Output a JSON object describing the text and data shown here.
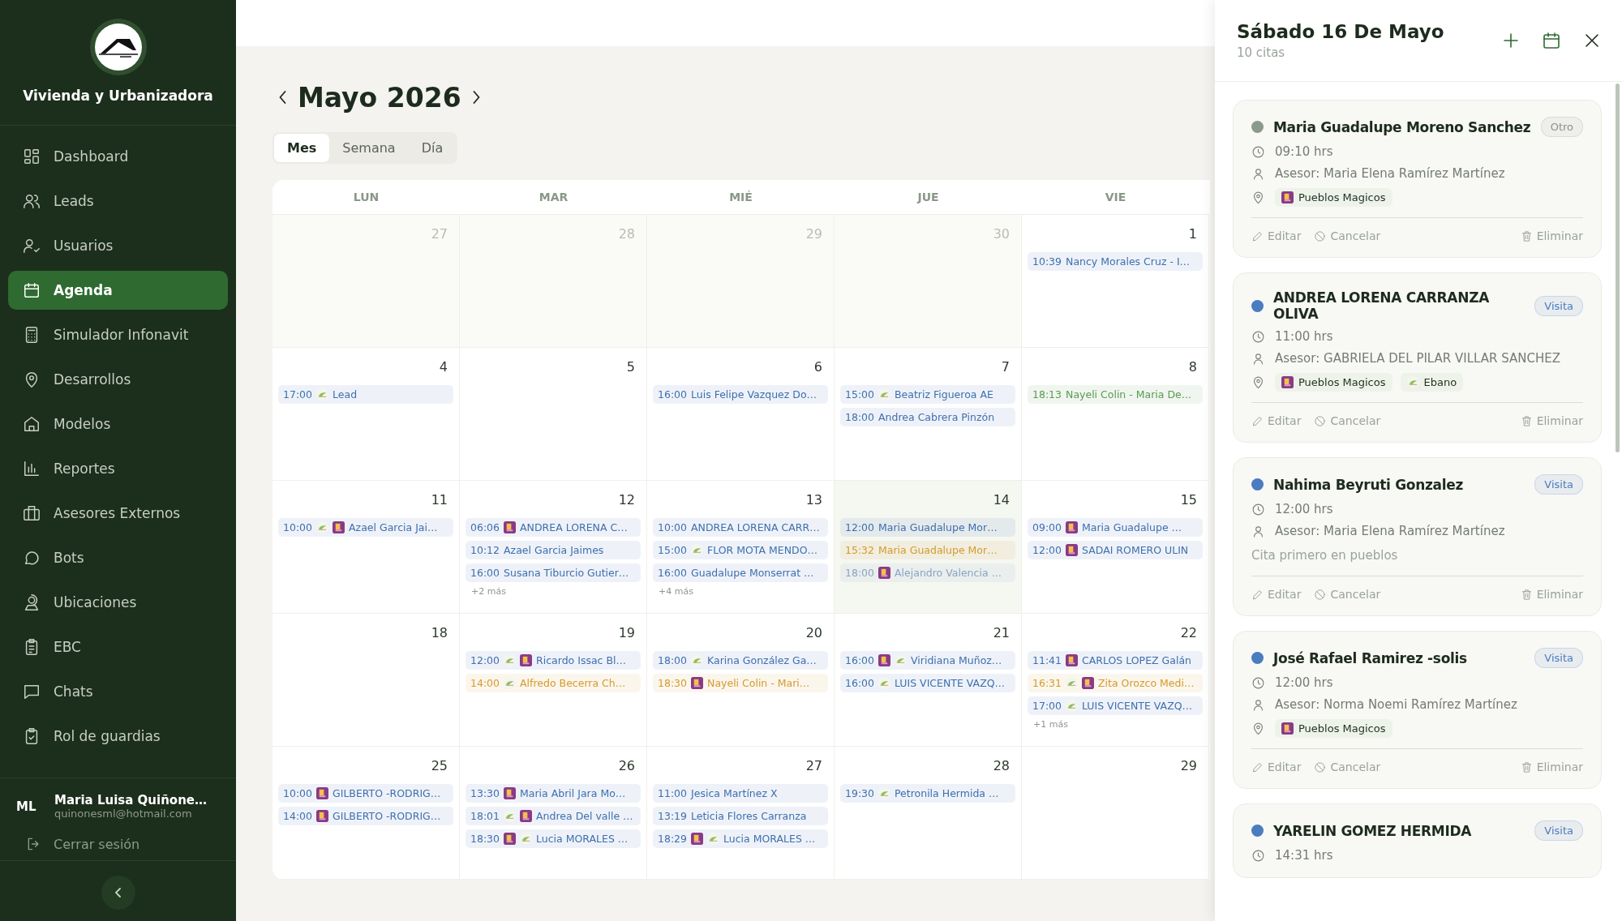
{
  "sidebar": {
    "brand": "Vivienda y Urbanizadora",
    "items": [
      {
        "label": "Dashboard",
        "selected": false
      },
      {
        "label": "Leads",
        "selected": false
      },
      {
        "label": "Usuarios",
        "selected": false
      },
      {
        "label": "Agenda",
        "selected": true
      },
      {
        "label": "Simulador Infonavit",
        "selected": false
      },
      {
        "label": "Desarrollos",
        "selected": false
      },
      {
        "label": "Modelos",
        "selected": false
      },
      {
        "label": "Reportes",
        "selected": false
      },
      {
        "label": "Asesores Externos",
        "selected": false
      },
      {
        "label": "Bots",
        "selected": false
      },
      {
        "label": "Ubicaciones",
        "selected": false
      },
      {
        "label": "EBC",
        "selected": false
      },
      {
        "label": "Chats",
        "selected": false
      },
      {
        "label": "Rol de guardias",
        "selected": false
      }
    ],
    "user": {
      "initials": "ML",
      "name": "Maria Luisa Quiñone…",
      "email": "quinonesml@hotmail.com"
    },
    "logout": "Cerrar sesión"
  },
  "header": {
    "month": "Mayo 2026"
  },
  "views": [
    {
      "label": "Mes",
      "selected": true
    },
    {
      "label": "Semana",
      "selected": false
    },
    {
      "label": "Día",
      "selected": false
    }
  ],
  "calendar": {
    "weekdays": [
      "LUN",
      "MAR",
      "MIÉ",
      "JUE",
      "VIE"
    ],
    "weeks": [
      [
        {
          "day": "27",
          "outside": true,
          "highlighted": false
        },
        {
          "day": "28",
          "outside": true,
          "highlighted": false
        },
        {
          "day": "29",
          "outside": true,
          "highlighted": false
        },
        {
          "day": "30",
          "outside": true,
          "highlighted": false
        },
        {
          "day": "1",
          "outside": false,
          "highlighted": false,
          "events": [
            {
              "time": "10:39",
              "title": "Nancy Morales Cruz - I…",
              "color": "#3e6fb0"
            }
          ]
        }
      ],
      [
        {
          "day": "4",
          "outside": false,
          "highlighted": false,
          "events": [
            {
              "time": "17:00",
              "title": "Lead",
              "color": "#3e6fb0",
              "logos": [
                {
                  "kind": "leaf"
                }
              ]
            }
          ]
        },
        {
          "day": "5",
          "outside": false,
          "highlighted": false
        },
        {
          "day": "6",
          "outside": false,
          "highlighted": false,
          "events": [
            {
              "time": "16:00",
              "title": "Luis Felipe Vazquez Do…",
              "color": "#3e6fb0"
            }
          ]
        },
        {
          "day": "7",
          "outside": false,
          "highlighted": false,
          "events": [
            {
              "time": "15:00",
              "title": "Beatriz Figueroa AE",
              "color": "#3e6fb0",
              "logos": [
                {
                  "kind": "leaf"
                }
              ]
            },
            {
              "time": "18:00",
              "title": "Andrea Cabrera Pinzón",
              "color": "#3e6fb0"
            }
          ]
        },
        {
          "day": "8",
          "outside": false,
          "highlighted": false,
          "events": [
            {
              "time": "18:13",
              "title": "Nayeli Colin - Maria De…",
              "color": "#5a9a52"
            }
          ]
        }
      ],
      [
        {
          "day": "11",
          "outside": false,
          "highlighted": false,
          "events": [
            {
              "time": "10:00",
              "title": "Azael Garcia Jai…",
              "color": "#3e6fb0",
              "logos": [
                {
                  "kind": "leaf"
                },
                {
                  "kind": "tile"
                }
              ]
            }
          ]
        },
        {
          "day": "12",
          "outside": false,
          "highlighted": false,
          "events": [
            {
              "time": "06:06",
              "title": "ANDREA LORENA C…",
              "color": "#3e6fb0",
              "logos": [
                {
                  "kind": "tile"
                }
              ]
            },
            {
              "time": "10:12",
              "title": "Azael Garcia Jaimes",
              "color": "#3e6fb0"
            },
            {
              "time": "16:00",
              "title": "Susana Tiburcio Gutier…",
              "color": "#3e6fb0"
            }
          ],
          "more": "+2 más"
        },
        {
          "day": "13",
          "outside": false,
          "highlighted": false,
          "events": [
            {
              "time": "10:00",
              "title": "ANDREA LORENA CARR…",
              "color": "#3e6fb0"
            },
            {
              "time": "15:00",
              "title": "FLOR MOTA MENDO…",
              "color": "#3e6fb0",
              "logos": [
                {
                  "kind": "leaf"
                }
              ]
            },
            {
              "time": "16:00",
              "title": "Guadalupe Monserrat …",
              "color": "#3e6fb0"
            }
          ],
          "more": "+4 más"
        },
        {
          "day": "14",
          "outside": false,
          "highlighted": true,
          "events": [
            {
              "time": "12:00",
              "title": "Maria Guadalupe Mor…",
              "color": "#3e6fb0"
            },
            {
              "time": "15:32",
              "title": "Maria Guadalupe Mor…",
              "color": "#d59a2e"
            },
            {
              "time": "18:00",
              "title": "Alejandro Valencia …",
              "color": "#8aa3c4",
              "logos": [
                {
                  "kind": "tile"
                }
              ]
            }
          ]
        },
        {
          "day": "15",
          "outside": false,
          "highlighted": false,
          "events": [
            {
              "time": "09:00",
              "title": "Maria Guadalupe …",
              "color": "#3e6fb0",
              "logos": [
                {
                  "kind": "tile"
                }
              ]
            },
            {
              "time": "12:00",
              "title": "SADAI ROMERO ULIN",
              "color": "#3e6fb0",
              "logos": [
                {
                  "kind": "tile"
                }
              ]
            }
          ]
        }
      ],
      [
        {
          "day": "18",
          "outside": false,
          "highlighted": false
        },
        {
          "day": "19",
          "outside": false,
          "highlighted": false,
          "events": [
            {
              "time": "12:00",
              "title": "Ricardo Issac Bl…",
              "color": "#3e6fb0",
              "logos": [
                {
                  "kind": "leaf"
                },
                {
                  "kind": "tile"
                }
              ]
            },
            {
              "time": "14:00",
              "title": "Alfredo Becerra Ch…",
              "color": "#d59a2e",
              "logos": [
                {
                  "kind": "leaf"
                }
              ]
            }
          ]
        },
        {
          "day": "20",
          "outside": false,
          "highlighted": false,
          "events": [
            {
              "time": "18:00",
              "title": "Karina González Ga…",
              "color": "#3e6fb0",
              "logos": [
                {
                  "kind": "leaf"
                }
              ]
            },
            {
              "time": "18:30",
              "title": "Nayeli Colin - Mari…",
              "color": "#d59a2e",
              "logos": [
                {
                  "kind": "tile"
                }
              ]
            }
          ]
        },
        {
          "day": "21",
          "outside": false,
          "highlighted": false,
          "events": [
            {
              "time": "16:00",
              "title": "Viridiana Muñoz…",
              "color": "#3e6fb0",
              "logos": [
                {
                  "kind": "tile"
                },
                {
                  "kind": "leaf"
                }
              ]
            },
            {
              "time": "16:00",
              "title": "LUIS VICENTE VAZQ…",
              "color": "#3e6fb0",
              "logos": [
                {
                  "kind": "leaf"
                }
              ]
            }
          ]
        },
        {
          "day": "22",
          "outside": false,
          "highlighted": false,
          "events": [
            {
              "time": "11:41",
              "title": "CARLOS LOPEZ Galán",
              "color": "#3e6fb0",
              "logos": [
                {
                  "kind": "tile"
                }
              ]
            },
            {
              "time": "16:31",
              "title": "Zita Orozco Medi…",
              "color": "#d59a2e",
              "logos": [
                {
                  "kind": "leaf"
                },
                {
                  "kind": "tile"
                }
              ]
            },
            {
              "time": "17:00",
              "title": "LUIS VICENTE VAZQ…",
              "color": "#3e6fb0",
              "logos": [
                {
                  "kind": "leaf"
                }
              ]
            }
          ],
          "more": "+1 más"
        }
      ],
      [
        {
          "day": "25",
          "outside": false,
          "highlighted": false,
          "events": [
            {
              "time": "10:00",
              "title": "GILBERTO -RODRIG…",
              "color": "#3e6fb0",
              "logos": [
                {
                  "kind": "tile"
                }
              ]
            },
            {
              "time": "14:00",
              "title": "GILBERTO -RODRIG…",
              "color": "#3e6fb0",
              "logos": [
                {
                  "kind": "tile"
                }
              ]
            }
          ]
        },
        {
          "day": "26",
          "outside": false,
          "highlighted": false,
          "events": [
            {
              "time": "13:30",
              "title": "Maria Abril Jara Mo…",
              "color": "#3e6fb0",
              "logos": [
                {
                  "kind": "tile"
                }
              ]
            },
            {
              "time": "18:01",
              "title": "Andrea Del valle …",
              "color": "#3e6fb0",
              "logos": [
                {
                  "kind": "leaf"
                },
                {
                  "kind": "tile"
                }
              ]
            },
            {
              "time": "18:30",
              "title": "Lucia MORALES …",
              "color": "#3e6fb0",
              "logos": [
                {
                  "kind": "tile"
                },
                {
                  "kind": "leaf"
                }
              ]
            }
          ]
        },
        {
          "day": "27",
          "outside": false,
          "highlighted": false,
          "events": [
            {
              "time": "11:00",
              "title": "Jesica Martínez X",
              "color": "#3e6fb0"
            },
            {
              "time": "13:19",
              "title": "Leticia Flores Carranza",
              "color": "#3e6fb0"
            },
            {
              "time": "18:29",
              "title": "Lucia MORALES …",
              "color": "#3e6fb0",
              "logos": [
                {
                  "kind": "tile"
                },
                {
                  "kind": "leaf"
                }
              ]
            }
          ]
        },
        {
          "day": "28",
          "outside": false,
          "highlighted": false,
          "events": [
            {
              "time": "19:30",
              "title": "Petronila Hermida …",
              "color": "#3e6fb0",
              "logos": [
                {
                  "kind": "leaf"
                }
              ]
            }
          ]
        },
        {
          "day": "29",
          "outside": false,
          "highlighted": false
        }
      ]
    ]
  },
  "panel": {
    "title": "Sábado 16 De Mayo",
    "count": "10 citas",
    "appointments": [
      {
        "color": "#8c9a8c",
        "name": "Maria Guadalupe Moreno Sanchez",
        "tag": {
          "label": "Otro",
          "color": "#8b918a"
        },
        "time": "09:10 hrs",
        "advisor": "Asesor: Maria Elena Ramírez Martínez",
        "places": [
          {
            "label": "Pueblos Magicos",
            "kind": "tile"
          }
        ],
        "actions": [
          {
            "label": "Editar",
            "kind": "edit"
          },
          {
            "label": "Cancelar",
            "kind": "cancel"
          },
          {
            "label": "Eliminar",
            "kind": "delete"
          }
        ]
      },
      {
        "color": "#4a7cc0",
        "name": "ANDREA LORENA CARRANZA OLIVA",
        "tag": {
          "label": "Visita",
          "color": "#4a7cc0"
        },
        "time": "11:00 hrs",
        "advisor": "Asesor: GABRIELA DEL PILAR VILLAR SANCHEZ",
        "places": [
          {
            "label": "Pueblos Magicos",
            "kind": "tile"
          },
          {
            "label": "Ebano",
            "kind": "leaf"
          }
        ],
        "actions": [
          {
            "label": "Editar",
            "kind": "edit"
          },
          {
            "label": "Cancelar",
            "kind": "cancel"
          },
          {
            "label": "Eliminar",
            "kind": "delete"
          }
        ]
      },
      {
        "color": "#4a7cc0",
        "name": "Nahima Beyruti Gonzalez",
        "tag": {
          "label": "Visita",
          "color": "#4a7cc0"
        },
        "time": "12:00 hrs",
        "advisor": "Asesor: Maria Elena Ramírez Martínez",
        "note": "Cita primero en pueblos",
        "actions": [
          {
            "label": "Editar",
            "kind": "edit"
          },
          {
            "label": "Cancelar",
            "kind": "cancel"
          },
          {
            "label": "Eliminar",
            "kind": "delete"
          }
        ]
      },
      {
        "color": "#4a7cc0",
        "name": "José Rafael Ramirez -solis",
        "tag": {
          "label": "Visita",
          "color": "#4a7cc0"
        },
        "time": "12:00 hrs",
        "advisor": "Asesor: Norma Noemi Ramírez Martínez",
        "places": [
          {
            "label": "Pueblos Magicos",
            "kind": "tile"
          }
        ],
        "actions": [
          {
            "label": "Editar",
            "kind": "edit"
          },
          {
            "label": "Cancelar",
            "kind": "cancel"
          },
          {
            "label": "Eliminar",
            "kind": "delete"
          }
        ]
      },
      {
        "color": "#4a7cc0",
        "name": "YARELIN GOMEZ HERMIDA",
        "tag": {
          "label": "Visita",
          "color": "#4a7cc0"
        },
        "time": "14:31 hrs"
      }
    ]
  }
}
